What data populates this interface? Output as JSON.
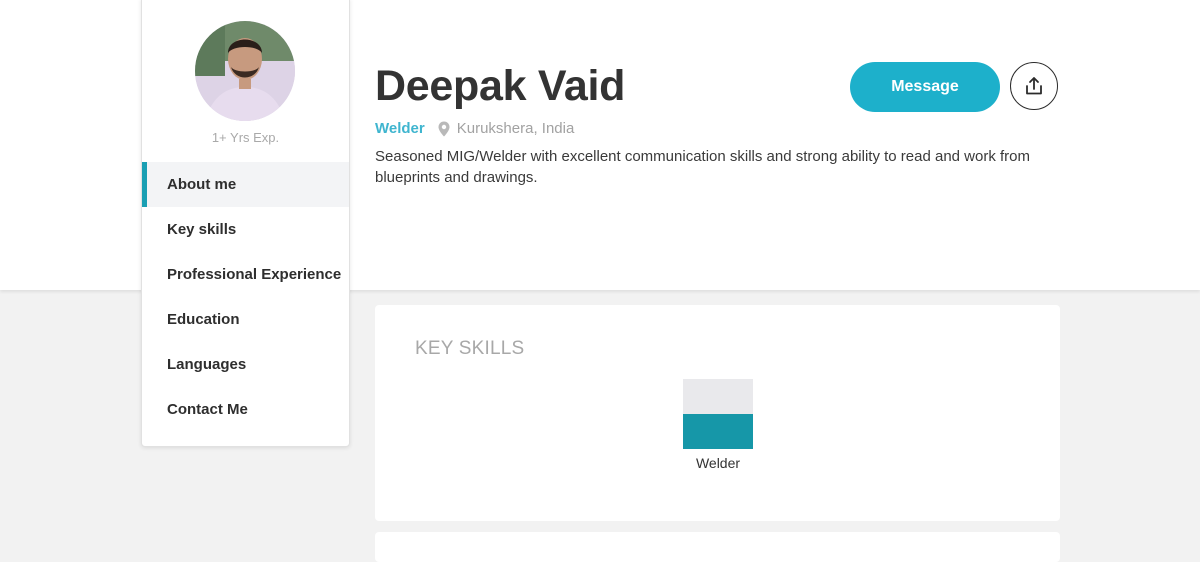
{
  "profile": {
    "name": "Deepak Vaid",
    "role": "Welder",
    "location": "Kurukshera, India",
    "experience": "1+ Yrs Exp.",
    "bio": "Seasoned MIG/Welder with excellent communication skills and strong ability to read and work from blueprints and drawings."
  },
  "actions": {
    "message_label": "Message",
    "share_icon": "share-icon"
  },
  "sidebar": {
    "items": [
      {
        "label": "About me",
        "active": true
      },
      {
        "label": "Key skills",
        "active": false
      },
      {
        "label": "Professional Experience",
        "active": false
      },
      {
        "label": "Education",
        "active": false
      },
      {
        "label": "Languages",
        "active": false
      },
      {
        "label": "Contact Me",
        "active": false
      }
    ]
  },
  "skills_card": {
    "title": "KEY SKILLS",
    "skills": [
      {
        "name": "Welder",
        "level": 0.5
      }
    ]
  },
  "colors": {
    "accent": "#1db0cb",
    "bar_fill": "#1697a8",
    "bar_bg": "#e9e9ec"
  }
}
